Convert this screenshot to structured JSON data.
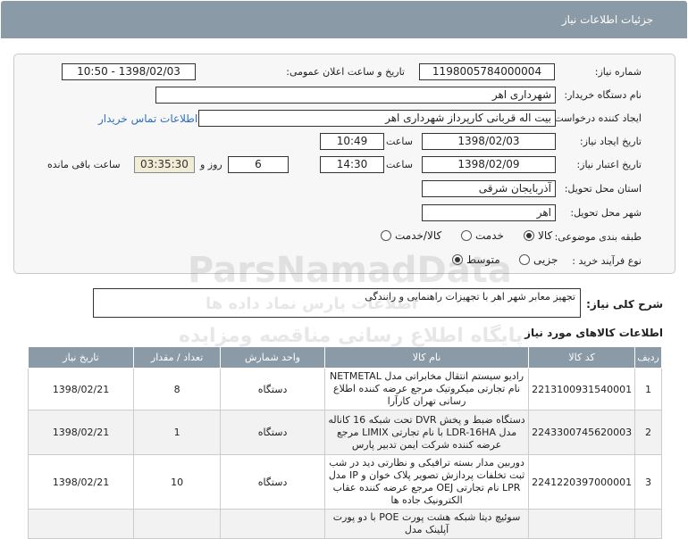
{
  "header": {
    "title": "جزئیات اطلاعات نیاز"
  },
  "fields": {
    "need_number_label": "شماره نیاز:",
    "need_number": "1198005784000004",
    "announce_label": "تاریخ و ساعت اعلان عمومی:",
    "announce_value": "1398/02/03 - 10:50",
    "buyer_label": "نام دستگاه خریدار:",
    "buyer_value": "شهرداری اهر",
    "creator_label": "ایجاد کننده درخواست:",
    "creator_value": "بیت اله قربانی کارپرداز شهرداری اهر",
    "contact_link": "اطلاعات تماس خریدار",
    "created_date_label": "تاریخ ایجاد نیاز:",
    "created_date": "1398/02/03",
    "created_time_label": "ساعت",
    "created_time": "10:49",
    "valid_date_label": "تاریخ اعتبار نیاز:",
    "valid_date": "1398/02/09",
    "valid_time_label": "ساعت",
    "valid_time": "14:30",
    "days": "6",
    "days_label": "روز و",
    "remaining": "03:35:30",
    "remaining_label": "ساعت باقی مانده",
    "province_label": "استان محل تحویل:",
    "province_value": "آذربایجان شرقی",
    "city_label": "شهر محل تحویل:",
    "city_value": "اهر",
    "category_label": "طبقه بندی موضوعی:",
    "category_options": [
      "کالا",
      "خدمت",
      "کالا/خدمت"
    ],
    "process_label": "نوع فرآیند خرید :",
    "process_options": [
      "جزیی",
      "متوسط"
    ]
  },
  "description": {
    "label": "شرح کلی نیاز:",
    "value": "تجهیز معابر شهر اهر با تجهیزات راهنمایی و رانندگی"
  },
  "goods": {
    "title": "اطلاعات کالاهای مورد نیاز",
    "headers": [
      "ردیف",
      "کد کالا",
      "نام کالا",
      "واحد شمارش",
      "تعداد / مقدار",
      "تاریخ نیاز"
    ],
    "rows": [
      {
        "n": "1",
        "code": "2213100931540001",
        "name": "رادیو سیستم انتقال مخابراتی مدل NETMETAL نام تجارتی میکروتیک مرجع عرضه کننده اطلاع رسانی تهران کارآرا",
        "unit": "دستگاه",
        "qty": "8",
        "date": "1398/02/21"
      },
      {
        "n": "2",
        "code": "2243300745620003",
        "name": "دستگاه ضبط و پخش DVR تحت شبکه 16 کاناله مدل LDR-16HA با نام تجارتی LIMIX مرجع عرضه کننده شرکت ایمن تدبیر پارس",
        "unit": "دستگاه",
        "qty": "1",
        "date": "1398/02/21"
      },
      {
        "n": "3",
        "code": "2241220397000001",
        "name": "دوربین مدار بسته ترافیکی و نظارتی دید در شب ثبت تخلفات پردازش تصویر پلاک خوان و IP مدل LPR نام تجارتی OEJ مرجع عرضه کننده عقاب الکترونیک جاده ها",
        "unit": "دستگاه",
        "qty": "10",
        "date": "1398/02/21"
      },
      {
        "n": "",
        "code": "",
        "name": "سوئیچ دیتا شبکه هشت پورت POE با دو پورت آپلینک مدل",
        "unit": "",
        "qty": "",
        "date": ""
      }
    ]
  },
  "watermark": {
    "brand": "ParsNamadData",
    "line1": "پایگاه اطلاع رسانی مناقصه ومزایده",
    "line2": "اطلاعات پارس نماد داده ها"
  }
}
